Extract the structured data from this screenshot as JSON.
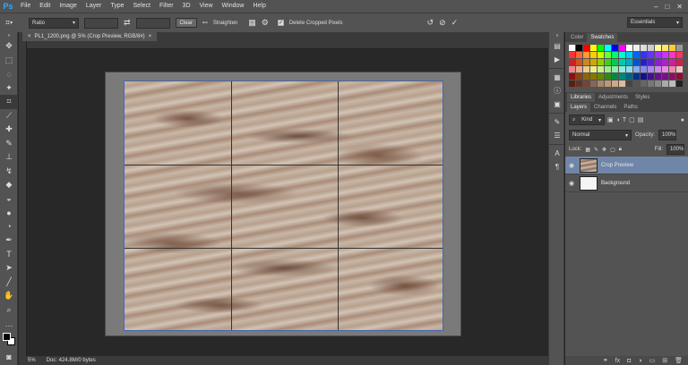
{
  "app": {
    "logo": "Ps"
  },
  "menu": [
    "File",
    "Edit",
    "Image",
    "Layer",
    "Type",
    "Select",
    "Filter",
    "3D",
    "View",
    "Window",
    "Help"
  ],
  "options": {
    "ratio": "Ratio",
    "clear": "Clear",
    "straighten": "Straighten",
    "delete_cropped": "Delete Cropped Pixels",
    "workspace": "Essentials"
  },
  "document": {
    "tab_title": "PL1_1200.png @ 5% (Crop Preview, RGB/8#)",
    "zoom": "5%",
    "doc_info": "Doc: 424.8M/0 bytes"
  },
  "panels": {
    "color_tabs": [
      "Color",
      "Swatches"
    ],
    "mid_tabs": [
      "Libraries",
      "Adjustments",
      "Styles"
    ],
    "layer_tabs": [
      "Layers",
      "Channels",
      "Paths"
    ],
    "kind_label": "Kind",
    "blend_mode": "Normal",
    "opacity_label": "Opacity:",
    "opacity_value": "100%",
    "lock_label": "Lock:",
    "fill_label": "Fill:",
    "fill_value": "100%",
    "layers": [
      {
        "name": "Crop Preview",
        "selected": true
      },
      {
        "name": "Background",
        "selected": false
      }
    ]
  },
  "swatches": [
    "#ffffff",
    "#000000",
    "#ff0000",
    "#ffff00",
    "#00ff00",
    "#00ffff",
    "#0000ff",
    "#ff00ff",
    "#ffffff",
    "#eeeeee",
    "#dddddd",
    "#cccccc",
    "#fff799",
    "#ffe666",
    "#ffcc33",
    "#999999",
    "#ff3333",
    "#ff6633",
    "#ff9933",
    "#ffcc00",
    "#ccff00",
    "#66ff33",
    "#00ff66",
    "#00ffcc",
    "#00ccff",
    "#0066ff",
    "#3333ff",
    "#6633ff",
    "#9933ff",
    "#cc33ff",
    "#ff33cc",
    "#ff3366",
    "#cc2222",
    "#cc5522",
    "#cc8822",
    "#ccaa00",
    "#99cc00",
    "#44cc22",
    "#00cc55",
    "#00ccaa",
    "#00aacc",
    "#0055cc",
    "#2222cc",
    "#5522cc",
    "#8822cc",
    "#aa22cc",
    "#cc2299",
    "#cc2255",
    "#ee8888",
    "#eeaa88",
    "#eecc88",
    "#eeee88",
    "#ccee88",
    "#99ee88",
    "#88eeaa",
    "#88eedd",
    "#88ddee",
    "#88aaee",
    "#8888ee",
    "#aa88ee",
    "#cc88ee",
    "#ee88dd",
    "#ee88aa",
    "#f4c2c2",
    "#881111",
    "#884411",
    "#886611",
    "#887700",
    "#668800",
    "#338811",
    "#008844",
    "#008877",
    "#006688",
    "#003388",
    "#111188",
    "#441188",
    "#661188",
    "#771188",
    "#881166",
    "#881133",
    "#552211",
    "#663322",
    "#774433",
    "#886655",
    "#aa8866",
    "#bb9977",
    "#ccaa88",
    "#ddbb99",
    "#444444",
    "#555555",
    "#666666",
    "#777777",
    "#888888",
    "#aaaaaa",
    "#bbbbbb",
    "#222222"
  ]
}
